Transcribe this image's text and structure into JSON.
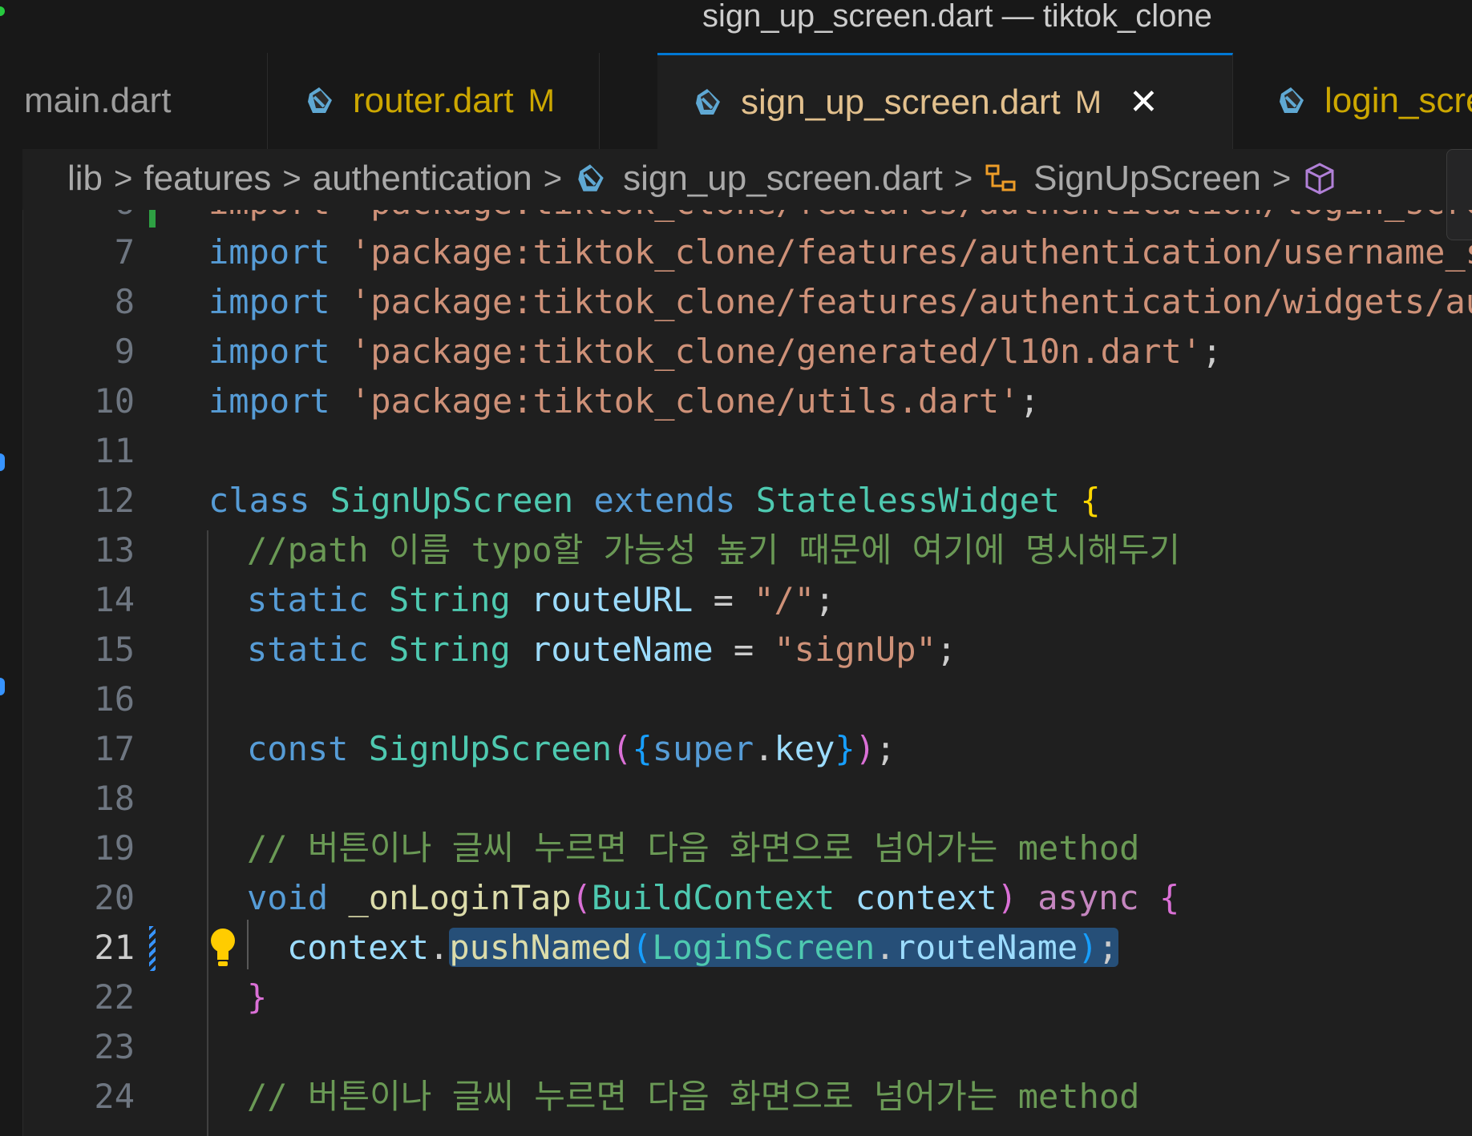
{
  "window": {
    "title": "sign_up_screen.dart — tiktok_clone"
  },
  "tabs": [
    {
      "label": "main.dart",
      "modified": "",
      "active": false
    },
    {
      "label": "router.dart",
      "modified": "M",
      "active": false
    },
    {
      "label": "sign_up_screen.dart",
      "modified": "M",
      "active": true,
      "close": "✕"
    },
    {
      "label": "login_scre",
      "modified": "",
      "active": false
    }
  ],
  "breadcrumb": {
    "items": [
      "lib",
      "features",
      "authentication",
      "sign_up_screen.dart",
      "SignUpScreen"
    ],
    "separator": ">"
  },
  "editor": {
    "current_line": 21,
    "lines": [
      {
        "n": "6",
        "text": "import 'package:tiktok_clone/features/authentication/login_screen.dart';"
      },
      {
        "n": "7",
        "k": "import",
        "s": "'package:tiktok_clone/features/authentication/username_screen.dart'",
        "e": ";"
      },
      {
        "n": "8",
        "k": "import",
        "s": "'package:tiktok_clone/features/authentication/widgets/auth_button.dart'",
        "e": ";"
      },
      {
        "n": "9",
        "k": "import",
        "s": "'package:tiktok_clone/generated/l10n.dart'",
        "e": ";"
      },
      {
        "n": "10",
        "k": "import",
        "s": "'package:tiktok_clone/utils.dart'",
        "e": ";"
      },
      {
        "n": "11"
      },
      {
        "n": "12",
        "c1": "class",
        "c2": "SignUpScreen",
        "c3": "extends",
        "c4": "StatelessWidget",
        "c5": "{"
      },
      {
        "n": "13",
        "comment": "//path 이름 typo할 가능성 높기 때문에 여기에 명시해두기"
      },
      {
        "n": "14",
        "a": "static",
        "b": "String",
        "v": "routeURL",
        "eq": "=",
        "s": "\"/\"",
        "e": ";"
      },
      {
        "n": "15",
        "a": "static",
        "b": "String",
        "v": "routeName",
        "eq": "=",
        "s": "\"signUp\"",
        "e": ";"
      },
      {
        "n": "16"
      },
      {
        "n": "17",
        "a": "const",
        "b": "SignUpScreen",
        "p1": "(",
        "p2": "{",
        "sup": "super",
        "dot": ".",
        "key": "key",
        "p3": "}",
        "p4": ")",
        "e": ";"
      },
      {
        "n": "18"
      },
      {
        "n": "19",
        "comment": "// 버튼이나 글씨 누르면 다음 화면으로 넘어가는 method"
      },
      {
        "n": "20",
        "a": "void",
        "fn": "_onLoginTap",
        "p1": "(",
        "t": "BuildContext",
        "v": "context",
        "p2": ")",
        "asy": "async",
        "br": "{"
      },
      {
        "n": "21",
        "obj": "context",
        "dot": ".",
        "fn": "pushNamed",
        "p1": "(",
        "cls": "LoginScreen",
        "dot2": ".",
        "prop": "routeName",
        "p2": ")",
        "e": ";"
      },
      {
        "n": "22",
        "br": "}"
      },
      {
        "n": "23"
      },
      {
        "n": "24",
        "comment": "// 버튼이나 글씨 누르면 다음 화면으로 넘어가는 method"
      }
    ]
  },
  "colors": {
    "keyword": "#569cd6",
    "string": "#ce9178",
    "type": "#4ec9b0",
    "function": "#dcdcaa",
    "variable": "#9cdcfe",
    "comment": "#6a9955",
    "selection": "#264f78",
    "active_tab_border": "#0078d4",
    "git_added": "#2ea043"
  },
  "icons": [
    "dart-file-icon",
    "class-icon",
    "field-icon",
    "lightbulb-icon",
    "close-icon",
    "chevron-right-icon"
  ]
}
